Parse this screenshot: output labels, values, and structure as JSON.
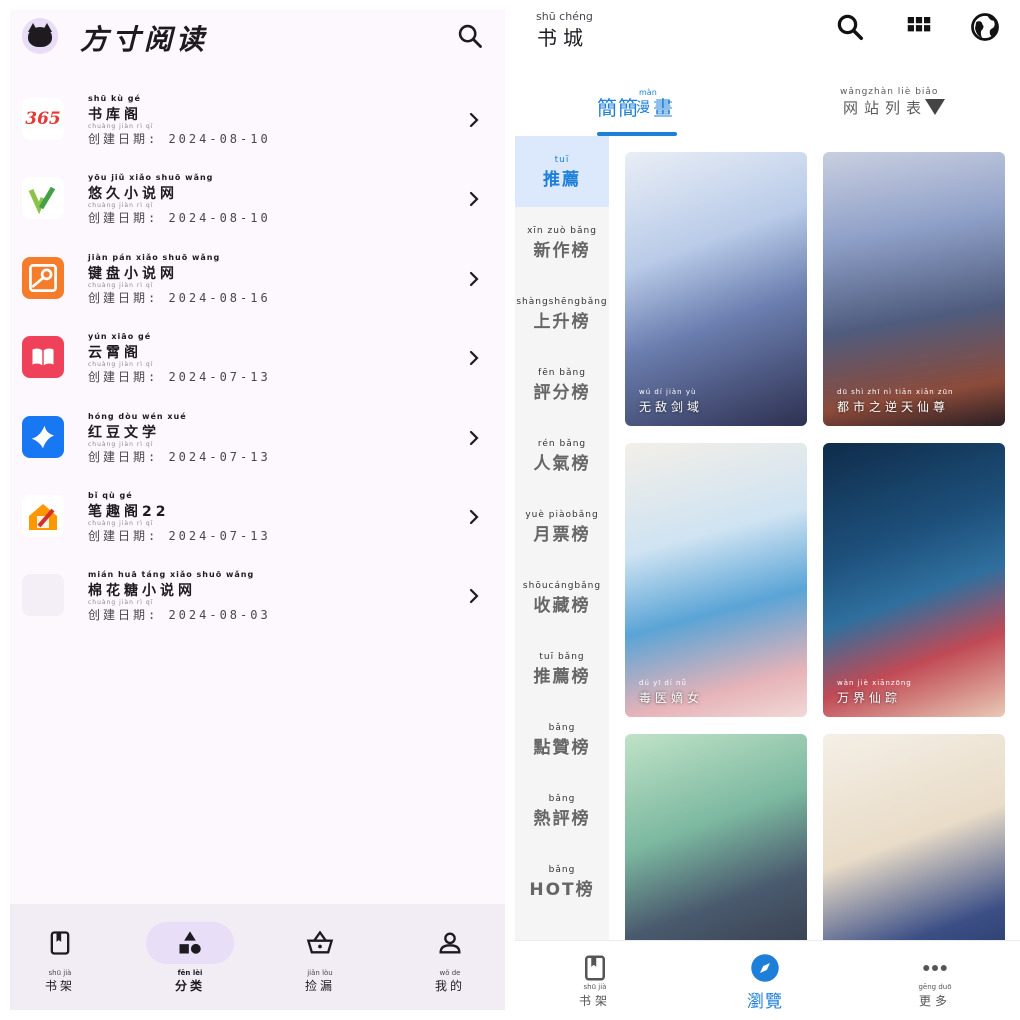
{
  "left": {
    "app_title": "方寸阅读",
    "icons": {
      "avatar": "cat-avatar-icon",
      "search": "search-icon"
    },
    "sources": [
      {
        "name_pinyin": "shū kù gé",
        "name": "书库阁",
        "date_pinyin": "chuàng jiàn rì qī",
        "date_label": "创建日期: 2024-08-10",
        "icon_text": "365",
        "icon_color": "#ffffff",
        "icon_fg": "#e53935"
      },
      {
        "name_pinyin": "yōu jiǔ xiǎo shuō wǎng",
        "name": "悠久小说网",
        "date_pinyin": "chuàng jiàn rì qī",
        "date_label": "创建日期: 2024-08-10",
        "icon_text": "",
        "icon_color": "#ffffff",
        "icon_fg": "#7cb342"
      },
      {
        "name_pinyin": "jiàn pán xiǎo shuō wǎng",
        "name": "键盘小说网",
        "date_pinyin": "chuàng jiàn rì qī",
        "date_label": "创建日期: 2024-08-16",
        "icon_text": "",
        "icon_color": "#f57c2b",
        "icon_fg": "#ffffff"
      },
      {
        "name_pinyin": "yún xiāo gé",
        "name": "云霄阁",
        "date_pinyin": "chuàng jiàn rì qī",
        "date_label": "创建日期: 2024-07-13",
        "icon_text": "",
        "icon_color": "#f0415a",
        "icon_fg": "#ffffff"
      },
      {
        "name_pinyin": "hóng dòu wén xué",
        "name": "红豆文学",
        "date_pinyin": "chuàng jiàn rì qī",
        "date_label": "创建日期: 2024-07-13",
        "icon_text": "",
        "icon_color": "#1877f2",
        "icon_fg": "#ffffff"
      },
      {
        "name_pinyin": "bǐ qù gé",
        "name": "笔趣阁22",
        "date_pinyin": "chuàng jiàn rì qī",
        "date_label": "创建日期: 2024-07-13",
        "icon_text": "",
        "icon_color": "#ffffff",
        "icon_fg": "#e65100"
      },
      {
        "name_pinyin": "mián huā táng xiǎo shuō wǎng",
        "name": "棉花糖小说网",
        "date_pinyin": "chuàng jiàn rì qī",
        "date_label": "创建日期: 2024-08-03",
        "icon_text": "",
        "icon_color": "#f4eff6",
        "icon_fg": "#f4eff6"
      }
    ],
    "nav": [
      {
        "pinyin": "shū jià",
        "label": "书架",
        "icon": "book-icon",
        "active": false
      },
      {
        "pinyin": "fēn lèi",
        "label": "分类",
        "icon": "shapes-icon",
        "active": true
      },
      {
        "pinyin": "jiǎn lòu",
        "label": "捡漏",
        "icon": "basket-icon",
        "active": false
      },
      {
        "pinyin": "wǒ de",
        "label": "我的",
        "icon": "person-icon",
        "active": false
      }
    ],
    "colors": {
      "background": "#fdf7fe",
      "nav_background": "#f2ecf4",
      "active_pill": "#e8def8"
    }
  },
  "right": {
    "title_pinyin": "shū chéng",
    "title": "书城",
    "icons": {
      "search": "search-icon",
      "grid": "grid-icon",
      "globe": "globe-icon"
    },
    "tab_main": "簡簡",
    "tab_main_small": "漫",
    "tab_main_tail": "畫",
    "tab_main_pinyin": "màn",
    "tab_sites_pinyin": "wǎngzhàn liè biǎo",
    "tab_sites": "网站列表",
    "categories": [
      {
        "pinyin": "tuī",
        "label": "推薦",
        "active": true
      },
      {
        "pinyin": "xīn zuò bǎng",
        "label": "新作榜",
        "active": false
      },
      {
        "pinyin": "shàngshēngbǎng",
        "label": "上升榜",
        "active": false
      },
      {
        "pinyin": "fēn bǎng",
        "label": "評分榜",
        "active": false
      },
      {
        "pinyin": "rén bǎng",
        "label": "人氣榜",
        "active": false
      },
      {
        "pinyin": "yuè piàobǎng",
        "label": "月票榜",
        "active": false
      },
      {
        "pinyin": "shōucángbǎng",
        "label": "收藏榜",
        "active": false
      },
      {
        "pinyin": "tuī bǎng",
        "label": "推薦榜",
        "active": false
      },
      {
        "pinyin": "bǎng",
        "label": "點贊榜",
        "active": false
      },
      {
        "pinyin": "bǎng",
        "label": "熱評榜",
        "active": false
      },
      {
        "pinyin": "bǎng",
        "label": "HOT榜",
        "active": false
      }
    ],
    "comics": [
      {
        "pinyin": "wú dí jiàn yù",
        "title": "无敌剑域"
      },
      {
        "pinyin": "dū shì zhī nì tiān xiān zūn",
        "title": "都市之逆天仙尊"
      },
      {
        "pinyin": "dú yī dí nǚ",
        "title": "毒医嫡女"
      },
      {
        "pinyin": "wàn jiè xiānzōng",
        "title": "万界仙踪"
      },
      {
        "pinyin": "",
        "title": ""
      },
      {
        "pinyin": "",
        "title": ""
      }
    ],
    "nav": [
      {
        "pinyin": "shū jià",
        "label": "书架",
        "icon": "book-icon",
        "active": false
      },
      {
        "pinyin": "",
        "label": "瀏覽",
        "icon": "compass-icon",
        "active": true
      },
      {
        "pinyin": "gēng duō",
        "label": "更多",
        "icon": "more-icon",
        "active": false
      }
    ],
    "colors": {
      "accent": "#1e7fd8",
      "sidebar": "#f5f5f5",
      "sidebar_active": "#dce8fb"
    }
  }
}
